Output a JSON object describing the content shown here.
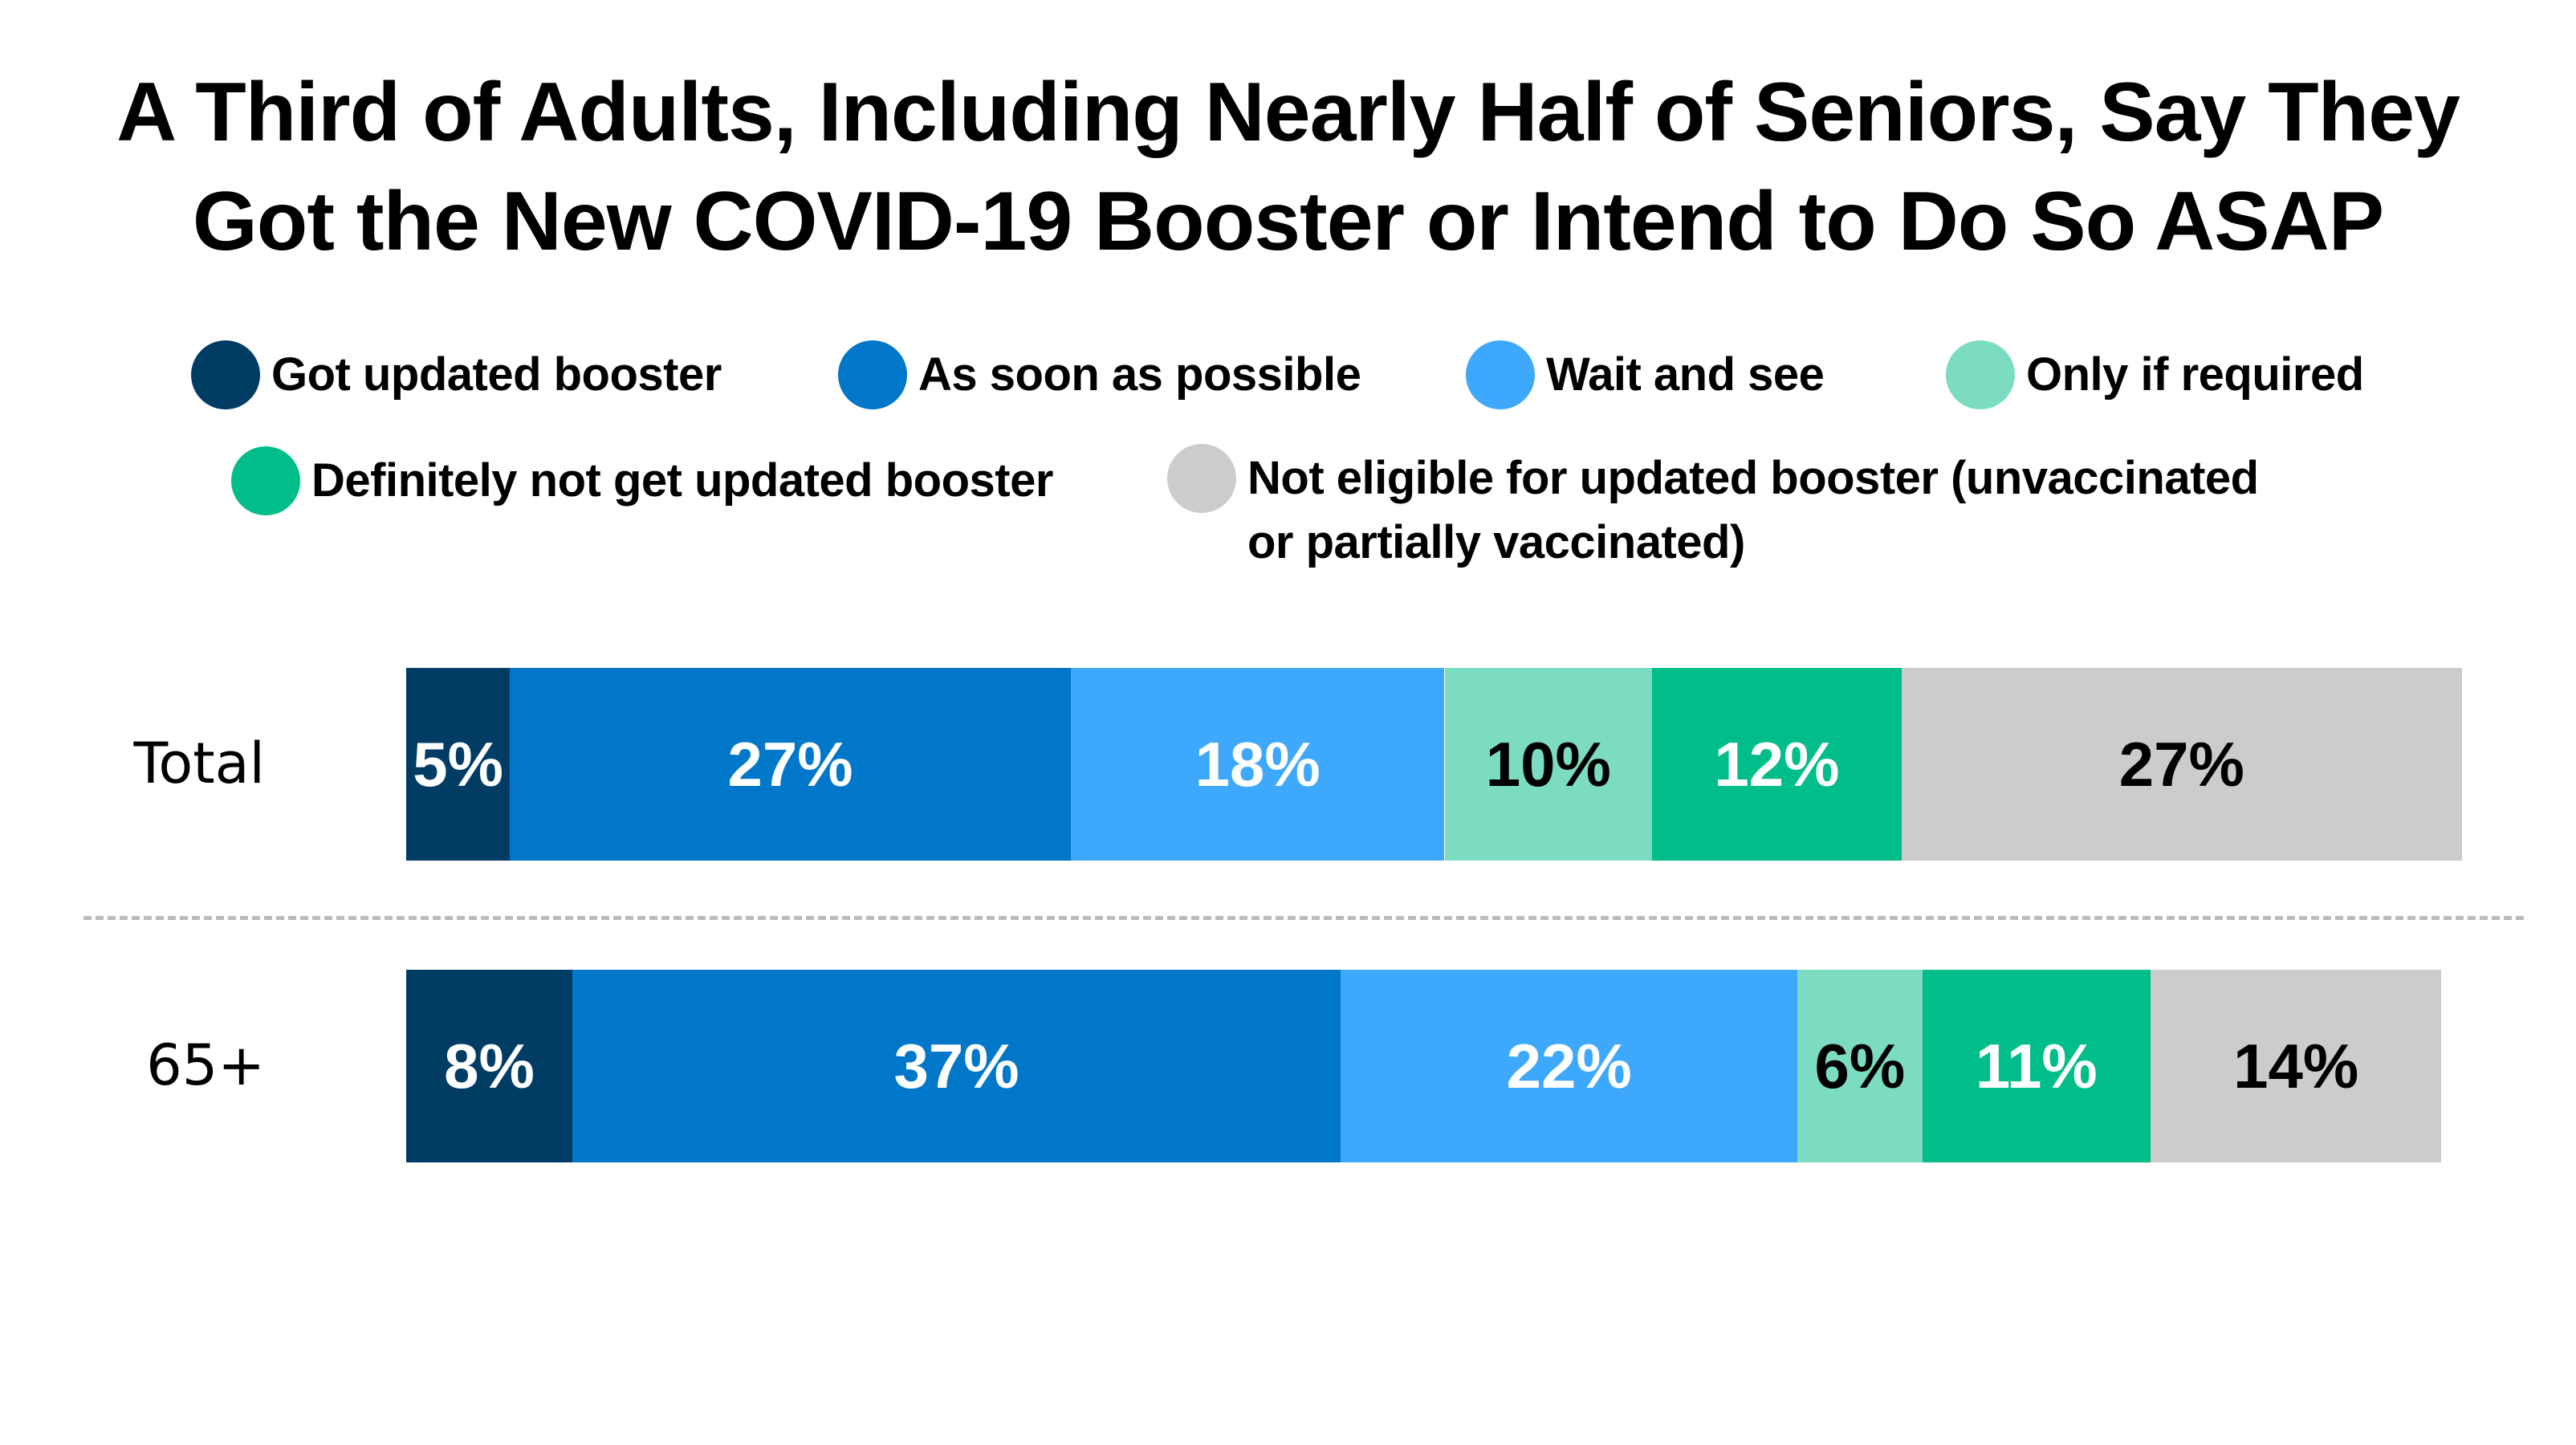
{
  "title_lines": [
    "A Third of Adults, Including Nearly Half of Seniors, Say They",
    "Got the New COVID-19 Booster or Intend to Do So ASAP"
  ],
  "legend": [
    {
      "label": "Got updated booster",
      "color": "#003c64"
    },
    {
      "label": "As soon as possible",
      "color": "#0077c8"
    },
    {
      "label": "Wait and see",
      "color": "#3ea9fc"
    },
    {
      "label": "Only if required",
      "color": "#7bdcc1"
    },
    {
      "label": "Definitely not get updated booster",
      "color": "#00bd89"
    },
    {
      "label_lines": [
        "Not eligible for updated booster (unvaccinated",
        "or partially vaccinated)"
      ],
      "color": "#cccccc"
    }
  ],
  "chart_data": {
    "type": "bar",
    "orientation": "horizontal",
    "stacked": true,
    "title": "A Third of Adults, Including Nearly Half of Seniors, Say They Got the New COVID-19 Booster or Intend to Do So ASAP",
    "categories": [
      "Total",
      "65+"
    ],
    "series": [
      {
        "name": "Got updated booster",
        "color": "#003c64",
        "label_color": "#ffffff",
        "values": [
          5,
          8
        ]
      },
      {
        "name": "As soon as possible",
        "color": "#0077c8",
        "label_color": "#ffffff",
        "values": [
          27,
          37
        ]
      },
      {
        "name": "Wait and see",
        "color": "#3ea9fc",
        "label_color": "#ffffff",
        "values": [
          18,
          22
        ]
      },
      {
        "name": "Only if required",
        "color": "#7bdcc1",
        "label_color": "#000000",
        "values": [
          10,
          6
        ]
      },
      {
        "name": "Definitely not get updated booster",
        "color": "#00bd89",
        "label_color": "#ffffff",
        "values": [
          12,
          11
        ]
      },
      {
        "name": "Not eligible for updated booster (unvaccinated or partially vaccinated)",
        "color": "#cccccc",
        "label_color": "#000000",
        "values": [
          27,
          14
        ]
      }
    ],
    "data_labels": [
      [
        "5%",
        "27%",
        "18%",
        "10%",
        "12%",
        "27%"
      ],
      [
        "8%",
        "37%",
        "22%",
        "6%",
        "11%",
        "14%"
      ]
    ],
    "value_suffix": "%",
    "xlim": [
      0,
      100
    ],
    "xlabel": "",
    "ylabel": "",
    "grid": false,
    "legend_position": "top",
    "separator": "dashed line between Total and 65+"
  }
}
